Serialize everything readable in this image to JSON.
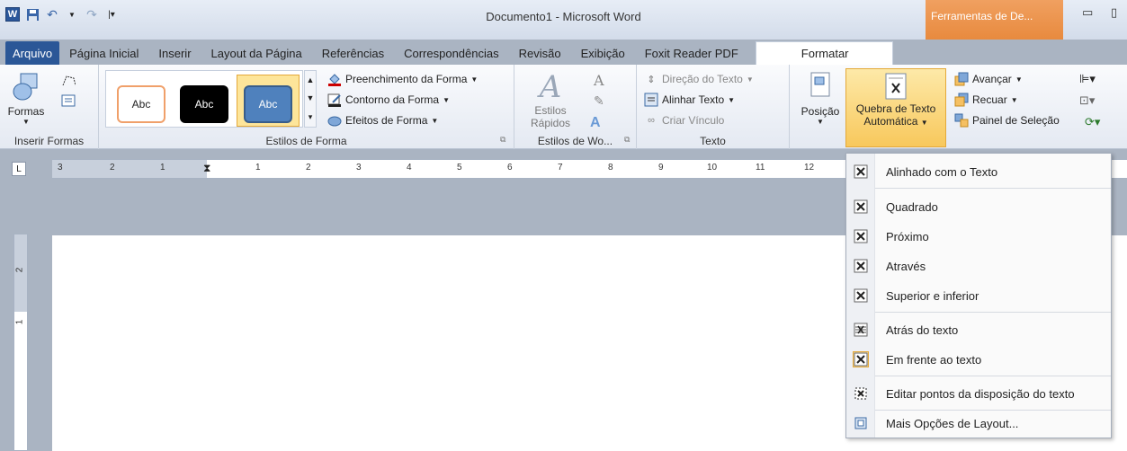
{
  "window": {
    "title": "Documento1 - Microsoft Word",
    "context_tab": "Ferramentas de De..."
  },
  "tabs": [
    "Arquivo",
    "Página Inicial",
    "Inserir",
    "Layout da Página",
    "Referências",
    "Correspondências",
    "Revisão",
    "Exibição",
    "Foxit Reader PDF",
    "Formatar"
  ],
  "ribbon": {
    "inserir_formas": {
      "label": "Inserir Formas",
      "formas": "Formas"
    },
    "estilos_forma": {
      "label": "Estilos de Forma",
      "gallery": [
        "Abc",
        "Abc",
        "Abc"
      ],
      "preenchimento": "Preenchimento da Forma",
      "contorno": "Contorno da Forma",
      "efeitos": "Efeitos de Forma"
    },
    "estilos_wordart": {
      "label": "Estilos de Wo...",
      "estilos": "Estilos",
      "rapidos": "Rápidos"
    },
    "texto": {
      "label": "Texto",
      "direcao": "Direção do Texto",
      "alinhar": "Alinhar Texto",
      "vinculo": "Criar Vínculo"
    },
    "organizar": {
      "posicao": "Posição",
      "quebra_line1": "Quebra de Texto",
      "quebra_line2": "Automática",
      "avancar": "Avançar",
      "recuar": "Recuar",
      "painel": "Painel de Seleção"
    }
  },
  "ruler": {
    "left_numbers": [
      "3",
      "2",
      "1"
    ],
    "right_numbers": [
      "1",
      "2",
      "3",
      "4",
      "5",
      "6",
      "7",
      "8",
      "9",
      "10",
      "11",
      "12"
    ],
    "v_numbers": [
      "2",
      "1"
    ]
  },
  "dropdown": {
    "items": [
      "Alinhado com o Texto",
      "Quadrado",
      "Próximo",
      "Através",
      "Superior e inferior",
      "Atrás do texto",
      "Em frente ao texto",
      "Editar pontos da disposição do texto",
      "Mais Opções de Layout..."
    ]
  }
}
